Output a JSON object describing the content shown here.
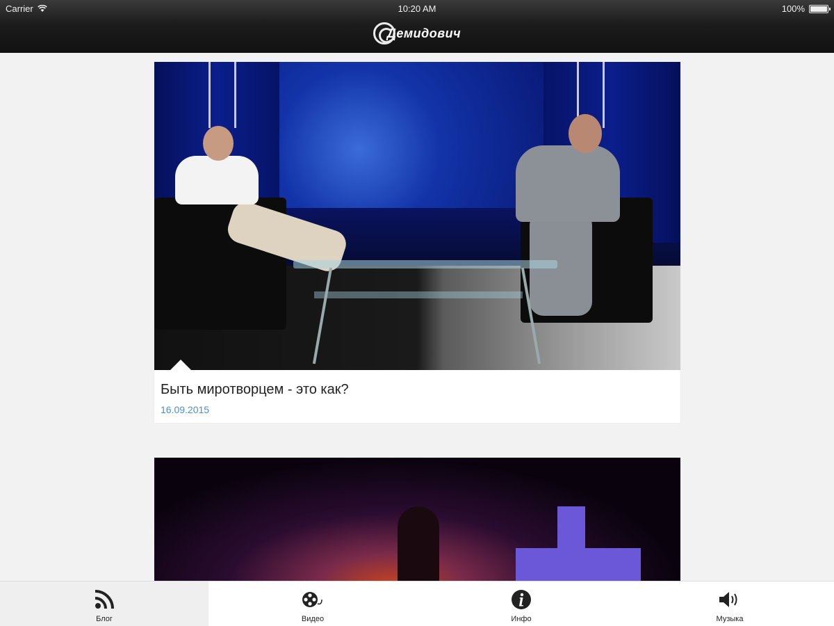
{
  "status_bar": {
    "carrier": "Carrier",
    "time": "10:20 AM",
    "battery": "100%"
  },
  "app": {
    "logo_text": "Демидович"
  },
  "feed": {
    "posts": [
      {
        "title": "Быть миротворцем - это как?",
        "date": "16.09.2015"
      },
      {
        "title": "",
        "date": ""
      }
    ]
  },
  "tabs": [
    {
      "label": "Блог",
      "icon": "rss-icon",
      "active": true
    },
    {
      "label": "Видео",
      "icon": "film-reel-icon",
      "active": false
    },
    {
      "label": "Инфо",
      "icon": "info-icon",
      "active": false
    },
    {
      "label": "Музыка",
      "icon": "speaker-icon",
      "active": false
    }
  ],
  "colors": {
    "date": "#4a8fd0",
    "topbar": "#1c1c1c",
    "background": "#f2f2f2"
  }
}
